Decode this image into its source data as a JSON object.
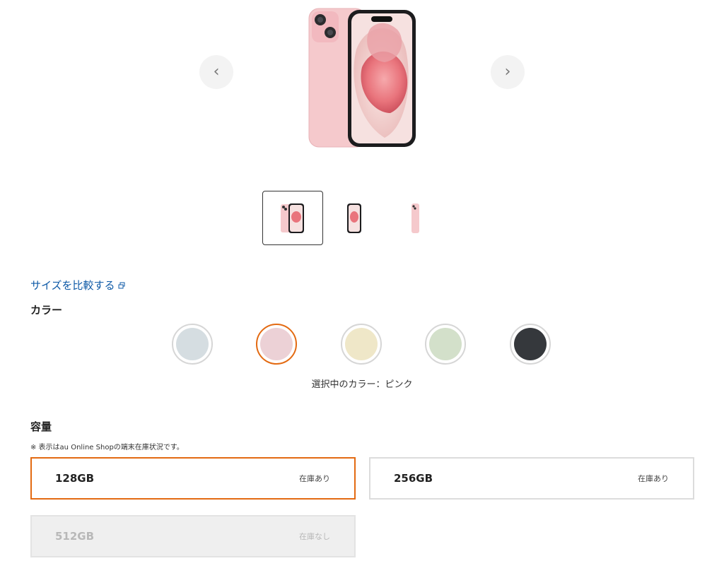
{
  "carousel": {
    "prev_icon": "chevron-left-icon",
    "next_icon": "chevron-right-icon",
    "prev_glyph": "‹",
    "next_glyph": "›"
  },
  "compare_link": {
    "label": "サイズを比較する",
    "icon": "external-link-icon",
    "color": "#0e5aa7"
  },
  "color_section": {
    "title": "カラー",
    "swatches": [
      {
        "name": "blue",
        "hex": "#d5dde1",
        "selected": false
      },
      {
        "name": "pink",
        "hex": "#ecd1d6",
        "selected": true
      },
      {
        "name": "yellow",
        "hex": "#efe7c8",
        "selected": false
      },
      {
        "name": "green",
        "hex": "#d3e0ca",
        "selected": false
      },
      {
        "name": "black",
        "hex": "#35383c",
        "selected": false
      }
    ],
    "selected_text": "選択中のカラー：ピンク"
  },
  "storage_section": {
    "title": "容量",
    "note": "※ 表示はau Online Shopの端末在庫状況です。",
    "options": [
      {
        "size": "128GB",
        "stock": "在庫あり",
        "selected": true,
        "available": true
      },
      {
        "size": "256GB",
        "stock": "在庫あり",
        "selected": false,
        "available": true
      },
      {
        "size": "512GB",
        "stock": "在庫なし",
        "selected": false,
        "available": false
      }
    ]
  },
  "colors": {
    "accent": "#e36a12",
    "link": "#0e5aa7",
    "phone_pink": "#f2c9cd"
  }
}
